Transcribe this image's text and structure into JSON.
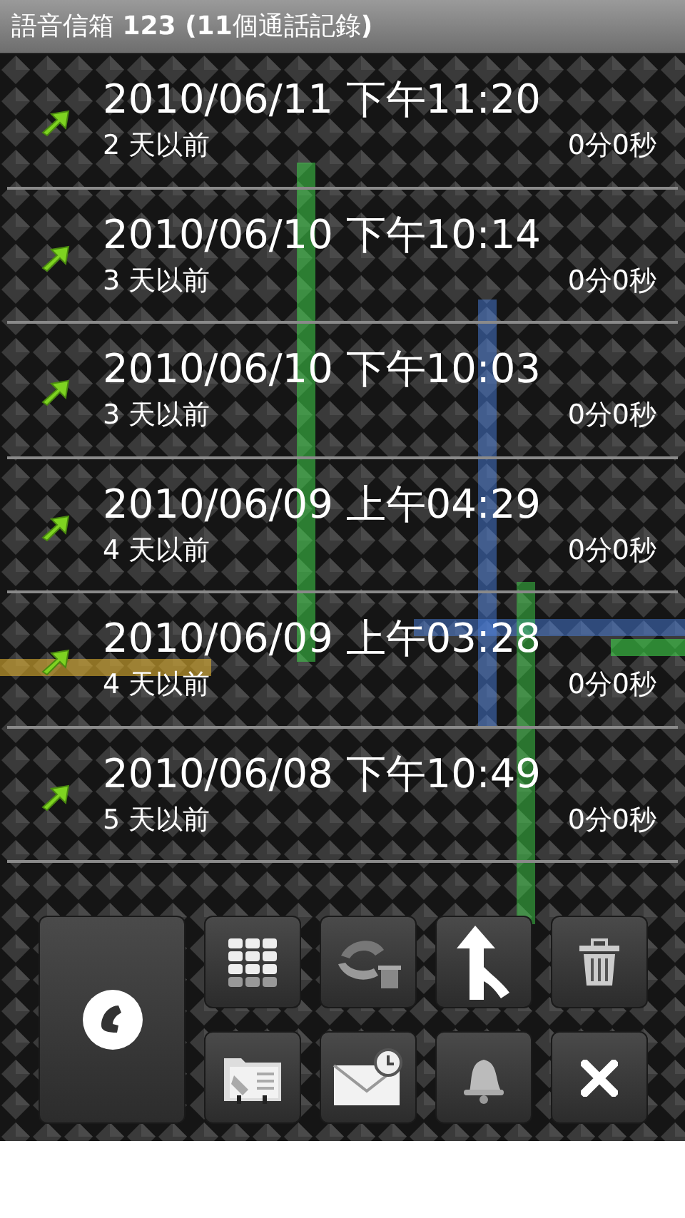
{
  "title": "語音信箱 **123 (11**個通話記錄**)**",
  "calls": [
    {
      "date": "2010/06/11 下午11:20",
      "ago": "2 天以前",
      "duration": "0分0秒"
    },
    {
      "date": "2010/06/10 下午10:14",
      "ago": "3 天以前",
      "duration": "0分0秒"
    },
    {
      "date": "2010/06/10 下午10:03",
      "ago": "3 天以前",
      "duration": "0分0秒"
    },
    {
      "date": "2010/06/09 上午04:29",
      "ago": "4 天以前",
      "duration": "0分0秒"
    },
    {
      "date": "2010/06/09 上午03:28",
      "ago": "4 天以前",
      "duration": "0分0秒"
    },
    {
      "date": "2010/06/08 下午10:49",
      "ago": "5 天以前",
      "duration": "0分0秒"
    }
  ],
  "toolbar": [
    {
      "kind": "call"
    },
    {
      "kind": "dialpad"
    },
    {
      "kind": "clear"
    },
    {
      "kind": "merge"
    },
    {
      "kind": "delete"
    },
    {
      "kind": "contacts"
    },
    {
      "kind": "message"
    },
    {
      "kind": "alert"
    },
    {
      "kind": "close"
    }
  ]
}
